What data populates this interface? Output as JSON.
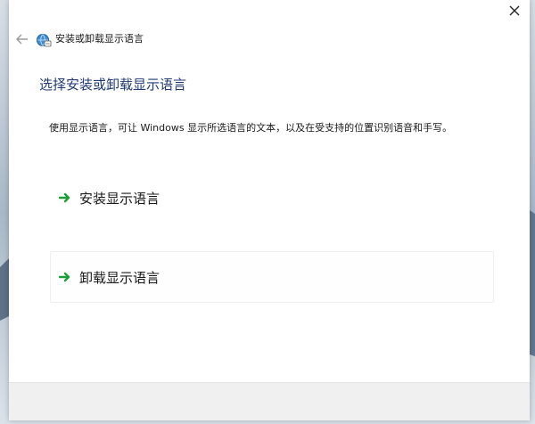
{
  "window": {
    "title": "安装或卸载显示语言"
  },
  "main": {
    "heading": "选择安装或卸载显示语言",
    "description": "使用显示语言，可让 Windows 显示所选语言的文本，以及在受支持的位置识别语音和手写。"
  },
  "options": [
    {
      "label": "安装显示语言",
      "icon": "green-arrow-icon"
    },
    {
      "label": "卸载显示语言",
      "icon": "green-arrow-icon"
    }
  ],
  "colors": {
    "heading": "#1f3b75",
    "arrow_green": "#1e9e3a",
    "footer_bg": "#f0f0f0"
  }
}
